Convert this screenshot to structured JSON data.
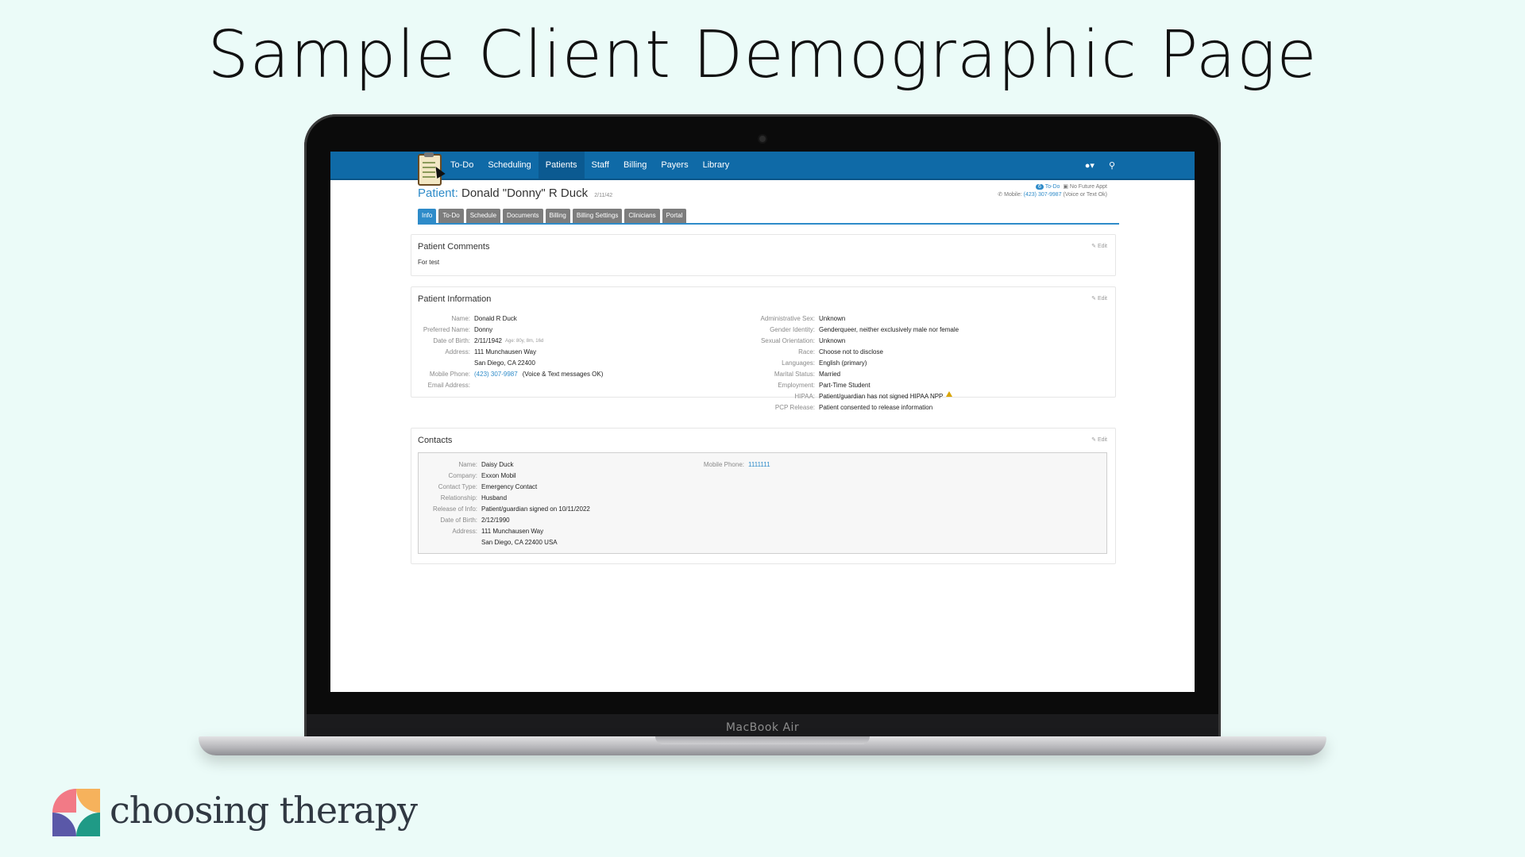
{
  "slide": {
    "title": "Sample Client Demographic Page"
  },
  "laptop": {
    "bezel_label": "MacBook Air"
  },
  "navbar": {
    "items": [
      "To-Do",
      "Scheduling",
      "Patients",
      "Staff",
      "Billing",
      "Payers",
      "Library"
    ],
    "active": "Patients",
    "icons": [
      "user-icon",
      "search-icon"
    ]
  },
  "patient": {
    "label": "Patient",
    "name": "Donald \"Donny\" R Duck",
    "dob_short": "2/11/42",
    "todo_count": "6",
    "todo_label": "To-Do",
    "no_appt": "No Future Appt",
    "mobile_label": "Mobile:",
    "mobile": "(423) 307-9987",
    "mobile_note": "(Voice or Text Ok)"
  },
  "tabs": [
    "Info",
    "To-Do",
    "Schedule",
    "Documents",
    "Billing",
    "Billing Settings",
    "Clinicians",
    "Portal"
  ],
  "active_tab": "Info",
  "comments": {
    "title": "Patient Comments",
    "edit": "Edit",
    "text": "For test"
  },
  "info": {
    "title": "Patient Information",
    "edit": "Edit",
    "left": [
      {
        "k": "Name:",
        "v": "Donald R Duck"
      },
      {
        "k": "Preferred Name:",
        "v": "Donny"
      },
      {
        "k": "Date of Birth:",
        "v": "2/11/1942",
        "extra": "Age: 80y, 8m, 16d"
      },
      {
        "k": "Address:",
        "v": "111 Munchausen Way"
      },
      {
        "k": "",
        "v": "San Diego, CA 22400"
      },
      {
        "k": "Mobile Phone:",
        "v": "(423) 307-9987",
        "extra2": "(Voice & Text messages OK)"
      },
      {
        "k": "Email Address:",
        "v": ""
      }
    ],
    "right": [
      {
        "k": "Administrative Sex:",
        "v": "Unknown"
      },
      {
        "k": "Gender Identity:",
        "v": "Genderqueer, neither exclusively male nor female"
      },
      {
        "k": "Sexual Orientation:",
        "v": "Unknown"
      },
      {
        "k": "Race:",
        "v": "Choose not to disclose"
      },
      {
        "k": "Languages:",
        "v": "English (primary)"
      },
      {
        "k": "Marital Status:",
        "v": "Married"
      },
      {
        "k": "Employment:",
        "v": "Part-Time Student"
      },
      {
        "k": "HIPAA:",
        "v": "Patient/guardian has not signed HIPAA NPP"
      },
      {
        "k": "PCP Release:",
        "v": "Patient consented to release information"
      }
    ]
  },
  "contacts": {
    "title": "Contacts",
    "edit": "Edit",
    "left": [
      {
        "k": "Name:",
        "v": "Daisy Duck"
      },
      {
        "k": "Company:",
        "v": "Exxon Mobil"
      },
      {
        "k": "Contact Type:",
        "v": "Emergency Contact"
      },
      {
        "k": "Relationship:",
        "v": "Husband"
      },
      {
        "k": "Release of Info:",
        "v": "Patient/guardian signed on 10/11/2022"
      },
      {
        "k": "Date of Birth:",
        "v": "2/12/1990"
      },
      {
        "k": "Address:",
        "v": "111 Munchausen Way"
      },
      {
        "k": "",
        "v": "San Diego, CA 22400 USA"
      }
    ],
    "right": [
      {
        "k": "Mobile Phone:",
        "v": "1111111"
      }
    ]
  },
  "brand": {
    "name": "choosing therapy",
    "colors": [
      "#f27a86",
      "#f6b25c",
      "#5a58a8",
      "#1f9a86"
    ]
  }
}
